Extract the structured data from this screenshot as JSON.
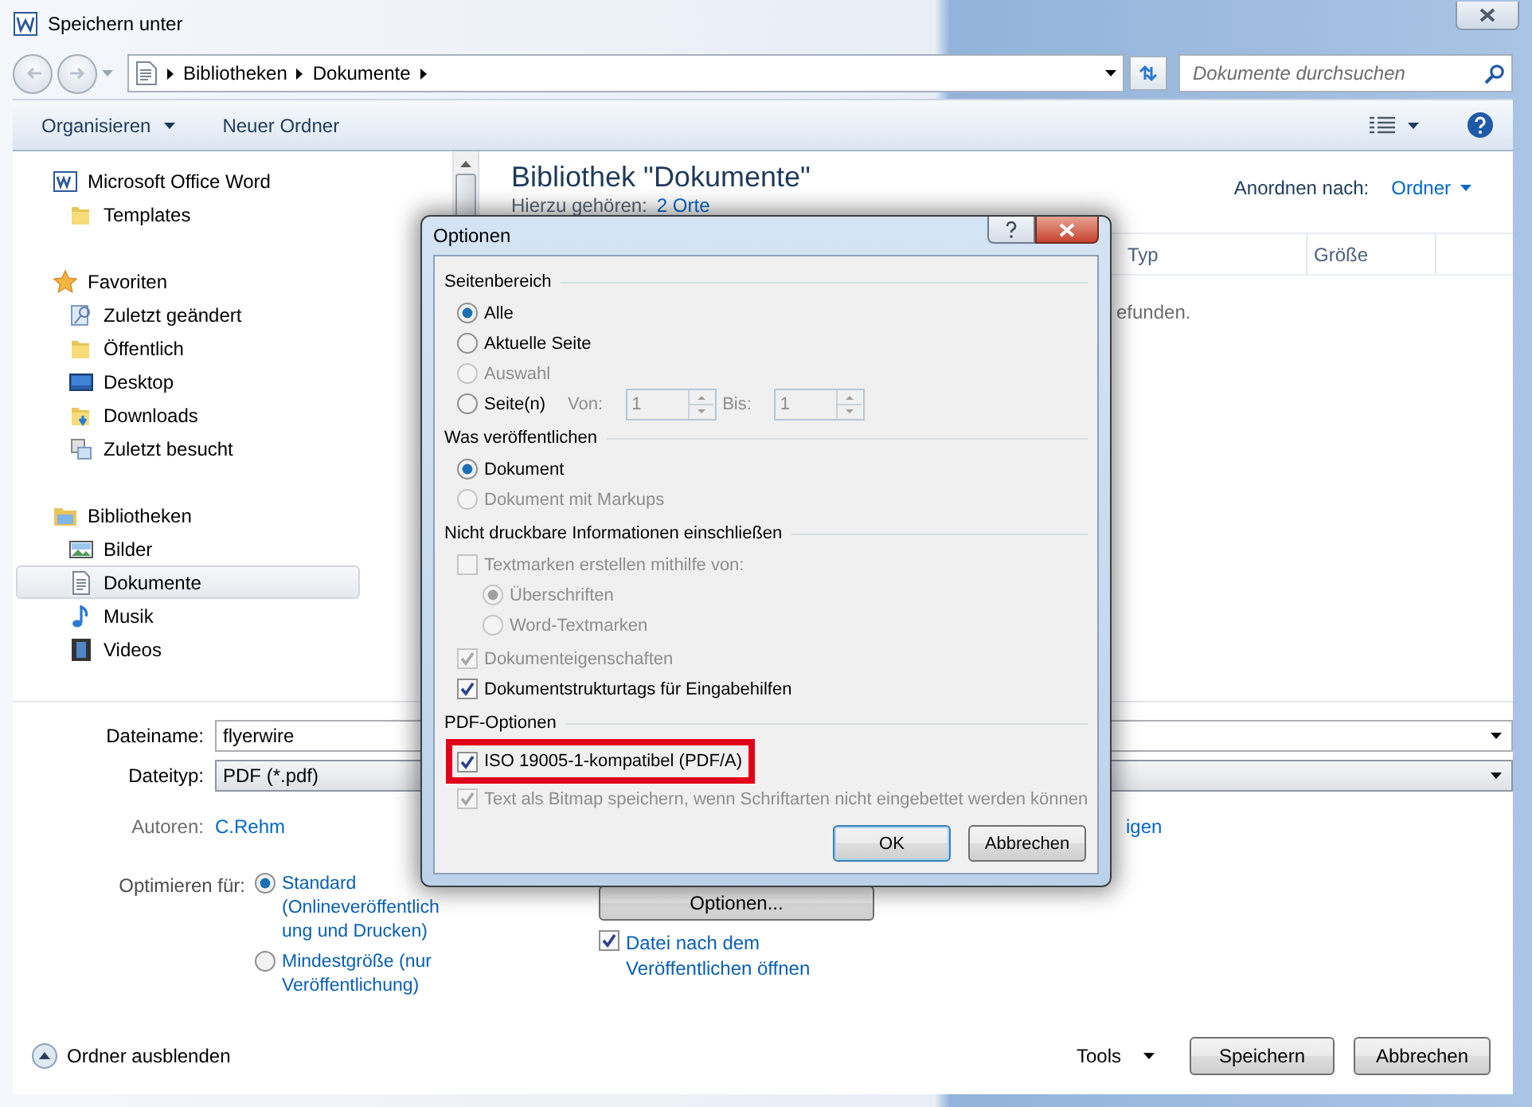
{
  "window": {
    "title": "Speichern unter"
  },
  "address_bar": {
    "path": [
      "Bibliotheken",
      "Dokumente"
    ]
  },
  "search": {
    "placeholder": "Dokumente durchsuchen"
  },
  "toolbar": {
    "buttons": [
      {
        "label": "Organisieren",
        "kind": "menu"
      },
      {
        "label": "Neuer Ordner",
        "kind": "plain"
      }
    ]
  },
  "sidebar": {
    "groups": [
      {
        "label": "Microsoft Office Word",
        "children": [
          {
            "label": "Templates",
            "selected": false
          }
        ]
      },
      {
        "label": "Favoriten",
        "children": [
          {
            "label": "Zuletzt geändert",
            "selected": false
          },
          {
            "label": "Öffentlich",
            "selected": false
          },
          {
            "label": "Desktop",
            "selected": false
          },
          {
            "label": "Downloads",
            "selected": false
          },
          {
            "label": "Zuletzt besucht",
            "selected": false
          }
        ]
      },
      {
        "label": "Bibliotheken",
        "children": [
          {
            "label": "Bilder",
            "selected": false
          },
          {
            "label": "Dokumente",
            "selected": true
          },
          {
            "label": "Musik",
            "selected": false
          },
          {
            "label": "Videos",
            "selected": false
          }
        ]
      }
    ]
  },
  "library": {
    "title": "Bibliothek \"Dokumente\"",
    "subtitle": "Hierzu gehören:",
    "locations_link": "2 Orte",
    "arrange_label": "Anordnen nach:",
    "arrange_value": "Ordner",
    "columns": [
      "Typ",
      "Größe"
    ],
    "empty_message": "efunden."
  },
  "form": {
    "filename_label": "Dateiname:",
    "filename": "flyerwire",
    "filetype_label": "Dateityp:",
    "filetype": "PDF (*.pdf)",
    "authors_label": "Autoren:",
    "author": "C.Rehm",
    "link_fragment": "igen",
    "optimize_label": "Optimieren für:",
    "optimize_options": [
      {
        "label": "Standard (Onlineveröffentlichung und Drucken)",
        "selected": true
      },
      {
        "label": "Mindestgröße (nur Veröffentlichung)",
        "selected": false
      }
    ],
    "options_button": "Optionen...",
    "open_after": {
      "label": "Datei nach dem Veröffentlichen öffnen",
      "checked": true
    }
  },
  "footer": {
    "hide_folders": "Ordner ausblenden",
    "tools": "Tools",
    "buttons": [
      "Speichern",
      "Abbrechen"
    ]
  },
  "dialog": {
    "title": "Optionen",
    "sections": [
      {
        "heading": "Seitenbereich",
        "items": [
          {
            "kind": "radio",
            "label": "Alle",
            "selected": true,
            "disabled": false
          },
          {
            "kind": "radio",
            "label": "Aktuelle Seite",
            "selected": false,
            "disabled": false
          },
          {
            "kind": "radio",
            "label": "Auswahl",
            "selected": false,
            "disabled": true
          },
          {
            "kind": "range",
            "label": "Seite(n)",
            "selected": false,
            "disabled": false,
            "fields_disabled": true,
            "from_label": "Von:",
            "from": "1",
            "to_label": "Bis:",
            "to": "1"
          }
        ]
      },
      {
        "heading": "Was veröffentlichen",
        "items": [
          {
            "kind": "radio",
            "label": "Dokument",
            "selected": true,
            "disabled": false
          },
          {
            "kind": "radio",
            "label": "Dokument mit Markups",
            "selected": false,
            "disabled": true
          }
        ]
      },
      {
        "heading": "Nicht druckbare Informationen einschließen",
        "items": [
          {
            "kind": "checkbox",
            "label": "Textmarken erstellen mithilfe von:",
            "checked": false,
            "disabled": true,
            "children": [
              {
                "kind": "radio",
                "label": "Überschriften",
                "selected": true,
                "disabled": true
              },
              {
                "kind": "radio",
                "label": "Word-Textmarken",
                "selected": false,
                "disabled": true
              }
            ]
          },
          {
            "kind": "checkbox",
            "label": "Dokumenteigenschaften",
            "checked": true,
            "disabled": true
          },
          {
            "kind": "checkbox",
            "label": "Dokumentstrukturtags für Eingabehilfen",
            "checked": true,
            "disabled": false
          }
        ]
      },
      {
        "heading": "PDF-Optionen",
        "items": [
          {
            "kind": "checkbox",
            "label": "ISO 19005-1-kompatibel (PDF/A)",
            "checked": true,
            "disabled": false,
            "highlighted": true
          },
          {
            "kind": "checkbox",
            "label": "Text als Bitmap speichern, wenn Schriftarten nicht eingebettet werden können",
            "checked": true,
            "disabled": true
          }
        ]
      }
    ],
    "buttons": [
      {
        "label": "OK",
        "default": true
      },
      {
        "label": "Abbrechen",
        "default": false
      }
    ]
  }
}
